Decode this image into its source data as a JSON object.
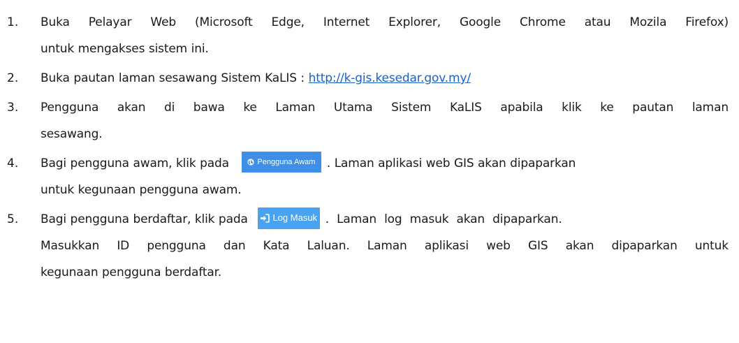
{
  "items": [
    {
      "number": "1.",
      "lines": [
        "Buka Pelayar Web (Microsoft Edge, Internet Explorer, Google Chrome atau Mozila Firefox)",
        "untuk mengakses sistem ini."
      ]
    },
    {
      "number": "2.",
      "text_before_link": "Buka pautan laman sesawang Sistem KaLIS : ",
      "link": "http://k-gis.kesedar.gov.my/"
    },
    {
      "number": "3.",
      "lines": [
        "Pengguna akan di bawa ke Laman Utama Sistem KaLIS apabila klik ke pautan laman",
        "sesawang."
      ]
    },
    {
      "number": "4.",
      "text_before_button": "Bagi pengguna awam, klik pada",
      "button": {
        "label": "Pengguna Awam",
        "icon": "globe-icon",
        "color": "#3f8ee8"
      },
      "text_after_button": ". Laman aplikasi web GIS akan dipaparkan",
      "line2": "untuk kegunaan pengguna awam."
    },
    {
      "number": "5.",
      "text_before_button": "Bagi pengguna berdaftar, klik pada",
      "button": {
        "label": "Log Masuk",
        "icon": "sign-in-icon",
        "color": "#4aa3f0"
      },
      "text_after_button": ".  Laman  log  masuk  akan  dipaparkan.",
      "line2": "Masukkan ID pengguna dan Kata Laluan. Laman aplikasi web GIS akan dipaparkan untuk",
      "line3": "kegunaan pengguna berdaftar."
    }
  ]
}
